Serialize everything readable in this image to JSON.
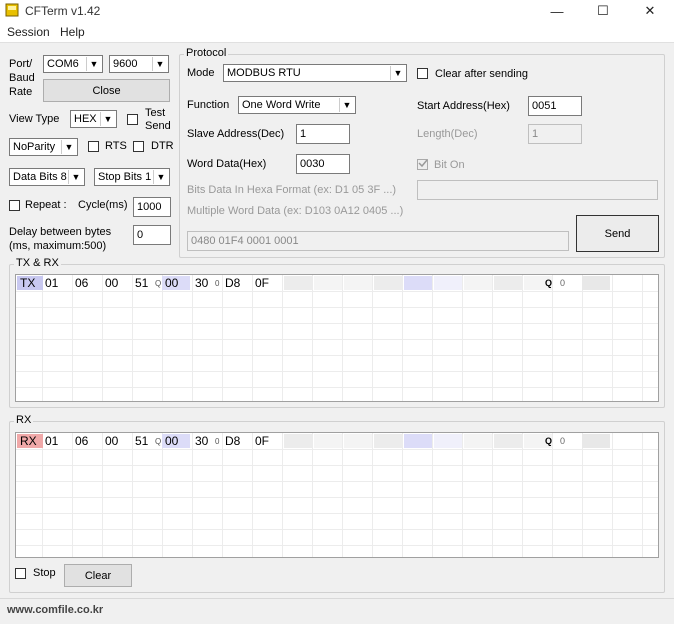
{
  "window": {
    "title": "CFTerm v1.42",
    "min": "—",
    "max": "☐",
    "close": "✕"
  },
  "menu": {
    "session": "Session",
    "help": "Help"
  },
  "left": {
    "port_label": "Port/\nBaud\nRate",
    "port": "COM6",
    "baud": "9600",
    "close_button": "Close",
    "view_type_label": "View Type",
    "view_type": "HEX",
    "test_send": "Test\nSend",
    "parity": "NoParity",
    "rts": "RTS",
    "dtr": "DTR",
    "data_bits": "Data Bits 8",
    "stop_bits": "Stop Bits 1",
    "repeat": "Repeat :",
    "cycle_label": "Cycle(ms)",
    "cycle": "1000",
    "delay_label": "Delay between bytes\n(ms, maximum:500)",
    "delay": "0"
  },
  "protocol": {
    "title": "Protocol",
    "mode_label": "Mode",
    "mode": "MODBUS RTU",
    "clear_after": "Clear after sending",
    "function_label": "Function",
    "function": "One Word Write",
    "start_label": "Start Address(Hex)",
    "start": "0051",
    "slave_label": "Slave Address(Dec)",
    "slave": "1",
    "length_label": "Length(Dec)",
    "length": "1",
    "word_label": "Word Data(Hex)",
    "word": "0030",
    "bit_on": "Bit On",
    "bits_hint": "Bits Data In Hexa Format (ex: D1 05 3F ...)",
    "multi_hint": "Multiple Word Data (ex: D103 0A12 0405 ...)",
    "frame": "0480 01F4 0001 0001",
    "send": "Send"
  },
  "txrx": {
    "title": "TX & RX",
    "tag": "TX",
    "bytes": [
      "01",
      "06",
      "00",
      "51",
      "00",
      "30",
      "D8",
      "0F"
    ],
    "subs": [
      "Q",
      "0"
    ],
    "tail_q": "Q",
    "tail_0": "0"
  },
  "rx": {
    "title": "RX",
    "tag": "RX",
    "bytes": [
      "01",
      "06",
      "00",
      "51",
      "00",
      "30",
      "D8",
      "0F"
    ],
    "subs": [
      "Q",
      "0"
    ],
    "tail_q": "Q",
    "tail_0": "0",
    "stop": "Stop",
    "clear": "Clear"
  },
  "footer": {
    "url": "www.comfile.co.kr"
  },
  "colors": {
    "tx_tag": "#c8c8f0",
    "rx_tag": "#f0a8a8",
    "hilite": "#dcdcf8"
  }
}
